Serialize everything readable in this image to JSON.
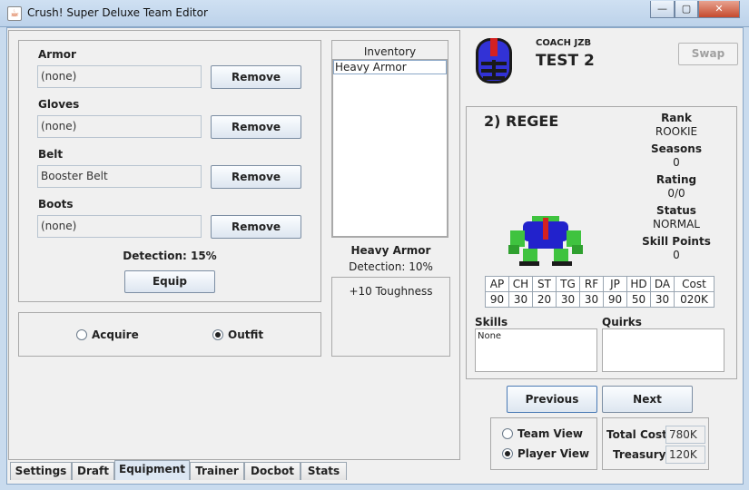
{
  "window": {
    "title": "Crush! Super Deluxe Team Editor",
    "minimize": "—",
    "maximize": "▢",
    "close": "✕"
  },
  "equipment": {
    "slots": [
      {
        "label": "Armor",
        "value": "(none)",
        "button": "Remove"
      },
      {
        "label": "Gloves",
        "value": "(none)",
        "button": "Remove"
      },
      {
        "label": "Belt",
        "value": "Booster Belt",
        "button": "Remove"
      },
      {
        "label": "Boots",
        "value": "(none)",
        "button": "Remove"
      }
    ],
    "detection": "Detection: 15%",
    "equip_button": "Equip"
  },
  "mode": {
    "acquire": "Acquire",
    "outfit": "Outfit",
    "selected": "Outfit"
  },
  "inventory": {
    "header": "Inventory",
    "items": [
      "Heavy Armor"
    ],
    "selected_name": "Heavy Armor",
    "selected_detection": "Detection: 10%",
    "effect": "+10 Toughness"
  },
  "team": {
    "coach": "COACH JZB",
    "name": "TEST 2",
    "swap_button": "Swap"
  },
  "player": {
    "title": "2) REGEE",
    "rank_label": "Rank",
    "rank": "ROOKIE",
    "seasons_label": "Seasons",
    "seasons": "0",
    "rating_label": "Rating",
    "rating": "0/0",
    "status_label": "Status",
    "status": "NORMAL",
    "skill_points_label": "Skill Points",
    "skill_points": "0",
    "stat_headers": [
      "AP",
      "CH",
      "ST",
      "TG",
      "RF",
      "JP",
      "HD",
      "DA",
      "Cost"
    ],
    "stat_values": [
      "90",
      "30",
      "20",
      "30",
      "30",
      "90",
      "50",
      "30",
      "020K"
    ],
    "skills_label": "Skills",
    "skills_value": "None",
    "quirks_label": "Quirks",
    "quirks_value": ""
  },
  "nav": {
    "previous": "Previous",
    "next": "Next"
  },
  "view": {
    "team_view": "Team View",
    "player_view": "Player View",
    "selected": "Player View"
  },
  "totals": {
    "total_cost_label": "Total Cost:",
    "total_cost": "780K",
    "treasury_label": "Treasury:",
    "treasury": "120K"
  },
  "tabs": [
    "Settings",
    "Draft",
    "Equipment",
    "Trainer",
    "Docbot",
    "Stats"
  ],
  "active_tab": "Equipment"
}
